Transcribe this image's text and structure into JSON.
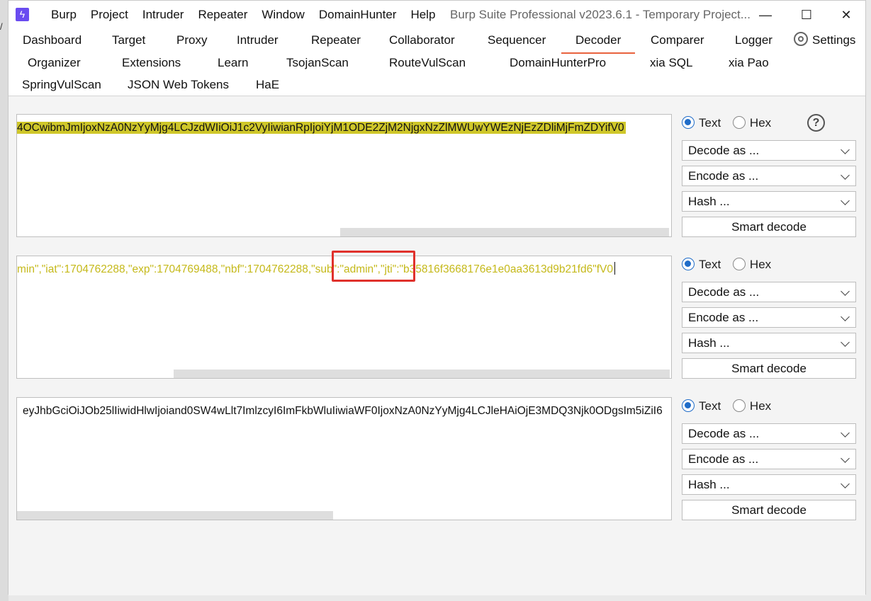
{
  "app": {
    "menu": [
      "Burp",
      "Project",
      "Intruder",
      "Repeater",
      "Window",
      "DomainHunter",
      "Help"
    ],
    "title": "Burp Suite Professional v2023.6.1 - Temporary Project..."
  },
  "tabs": {
    "row1": [
      "Dashboard",
      "Target",
      "Proxy",
      "Intruder",
      "Repeater",
      "Collaborator",
      "Sequencer",
      "Decoder",
      "Comparer",
      "Logger",
      "Settings"
    ],
    "row2": [
      "Organizer",
      "Extensions",
      "Learn",
      "TsojanScan",
      "RouteVulScan",
      "DomainHunterPro",
      "xia SQL",
      "xia Pao"
    ],
    "row3": [
      "SpringVulScan",
      "JSON Web Tokens",
      "HaE"
    ],
    "active": "Decoder"
  },
  "panels": [
    {
      "text": "4OCwibmJmIjoxNzA0NzYyMjg4LCJzdWIiOiJ1c2VyIiwianRpIjoiYjM1ODE2ZjM2NjgxNzZlMWUwYWEzNjEzZDliMjFmZDYifV0",
      "radio_text": "Text",
      "radio_hex": "Hex",
      "selected": "Text",
      "decode_label": "Decode as ...",
      "encode_label": "Encode as ...",
      "hash_label": "Hash ...",
      "smart_label": "Smart decode"
    },
    {
      "text_before": "min\",\"iat\":1704762288,\"exp\":1704769488,\"nbf\":1704762288,",
      "text_highlight": "\"sub\":\"admin\",",
      "text_after": "\"jti\":\"b35816f3668176e1e0aa3613d9b21fd6\"fV0",
      "radio_text": "Text",
      "radio_hex": "Hex",
      "selected": "Text",
      "decode_label": "Decode as ...",
      "encode_label": "Encode as ...",
      "hash_label": "Hash ...",
      "smart_label": "Smart decode"
    },
    {
      "text": "eyJhbGciOiJOb25lIiwidHlwIjoiand0SW4wLlt7ImlzcyI6ImFkbWluIiwiaWF0IjoxNzA0NzYyMjg4LCJleHAiOjE3MDQ3Njk0ODgsIm5iZiI6",
      "radio_text": "Text",
      "radio_hex": "Hex",
      "selected": "Text",
      "decode_label": "Decode as ...",
      "encode_label": "Encode as ...",
      "hash_label": "Hash ...",
      "smart_label": "Smart decode"
    }
  ],
  "colors": {
    "accent": "#e8623d",
    "highlight": "#cfc72a",
    "decoded_text": "#c5b91a",
    "annotation": "#e0312c",
    "radio": "#1f6cc8"
  },
  "icons": {
    "app": "burp-lightning-icon",
    "settings": "gear-icon",
    "help": "question-circle-icon"
  }
}
